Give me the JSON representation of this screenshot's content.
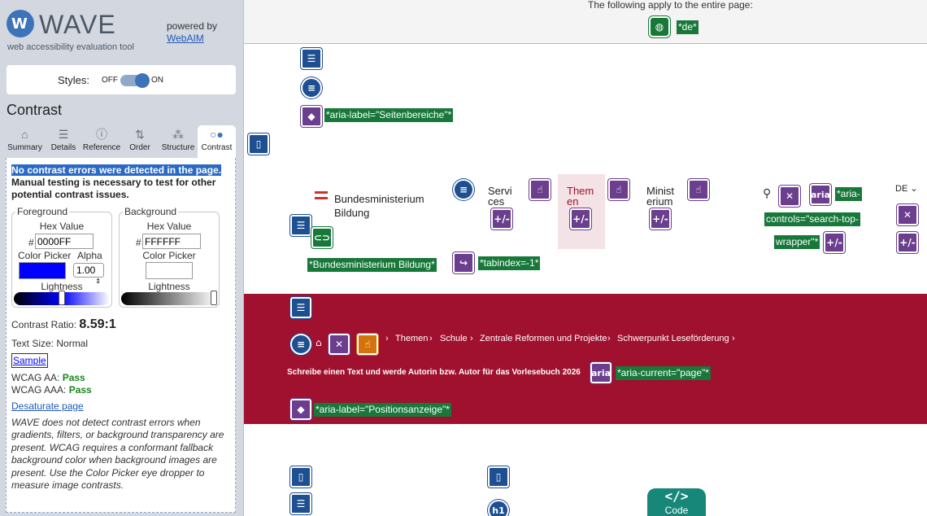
{
  "sidebar": {
    "logo_word": "WAVE",
    "logo_tagline": "web accessibility evaluation tool",
    "powered_by": "powered by",
    "powered_link": "WebAIM",
    "styles_label": "Styles:",
    "styles_off": "OFF",
    "styles_on": "ON",
    "panel_title": "Contrast",
    "tabs": [
      {
        "label": "Summary",
        "icon": "home-icon",
        "glyph": "⌂"
      },
      {
        "label": "Details",
        "icon": "list-icon",
        "glyph": "☰"
      },
      {
        "label": "Reference",
        "icon": "info-icon",
        "glyph": "ⓘ"
      },
      {
        "label": "Order",
        "icon": "order-icon",
        "glyph": "⇅"
      },
      {
        "label": "Structure",
        "icon": "structure-icon",
        "glyph": "⁂"
      },
      {
        "label": "Contrast",
        "icon": "contrast-icon",
        "glyph": "○●"
      }
    ],
    "message_highlight": "No contrast errors were detected in the page.",
    "message_rest": "Manual testing is necessary to test for other potential contrast issues.",
    "foreground": {
      "legend": "Foreground",
      "hex_label": "Hex Value",
      "hash": "#",
      "hex": "0000FF",
      "picker_label": "Color Picker",
      "alpha_label": "Alpha",
      "alpha": "1.00",
      "lightness_label": "Lightness",
      "color": "#0000ff",
      "lightness": 0.5
    },
    "background": {
      "legend": "Background",
      "hex_label": "Hex Value",
      "hash": "#",
      "hex": "FFFFFF",
      "picker_label": "Color Picker",
      "lightness_label": "Lightness",
      "color": "#ffffff",
      "lightness": 1.0
    },
    "ratio_label": "Contrast Ratio:",
    "ratio_value": "8.59:1",
    "text_size": "Text Size: Normal",
    "sample": "Sample",
    "aa_label": "WCAG AA:",
    "aa_value": "Pass",
    "aaa_label": "WCAG AAA:",
    "aaa_value": "Pass",
    "desaturate": "Desaturate page",
    "note": "WAVE does not detect contrast errors when gradients, filters, or background transparency are present. WCAG requires a conformant fallback background color when background images are present. Use the Color Picker eye dropper to measure image contrasts."
  },
  "page": {
    "applies_text": "The following apply to the entire page:",
    "lang_label": "*de*",
    "aria_label_sections": "*aria-label=\"Seitenbereiche\"*",
    "ministry_name_1": "Bundesministerium",
    "ministry_name_2": "Bildung",
    "ministry_link_label": "*Bundesministerium Bildung*",
    "tabindex_label": "*tabindex=-1*",
    "nav_services_1": "Servi",
    "nav_services_2": "ces",
    "nav_themen_1": "Them",
    "nav_themen_2": "en",
    "nav_ministerium_1": "Minist",
    "nav_ministerium_2": "erium",
    "aria_text": "aria",
    "aria_controls_1": "*aria-",
    "aria_controls_2": "controls=\"search-top-",
    "aria_controls_3": "wrapper\"*",
    "lang_switch": "DE",
    "breadcrumbs": [
      "Themen",
      "Schule",
      "Zentrale Reformen und Projekte",
      "Schwerpunkt Leseförderung"
    ],
    "headline": "Schreibe einen Text und werde Autorin bzw. Autor für das Vorlesebuch 2026",
    "aria_current": "*aria-current=\"page\"*",
    "aria_label_position": "*aria-label=\"Positionsanzeige\"*",
    "heading_badge": "h1",
    "code_badge": "Code",
    "code_glyph": "</>",
    "expand_glyph": "+/-"
  },
  "colors": {
    "accent": "#3c73b9",
    "band": "#a0102f",
    "label_green": "#17783a",
    "purple": "#6b3e8e",
    "navy": "#1d4f91"
  }
}
